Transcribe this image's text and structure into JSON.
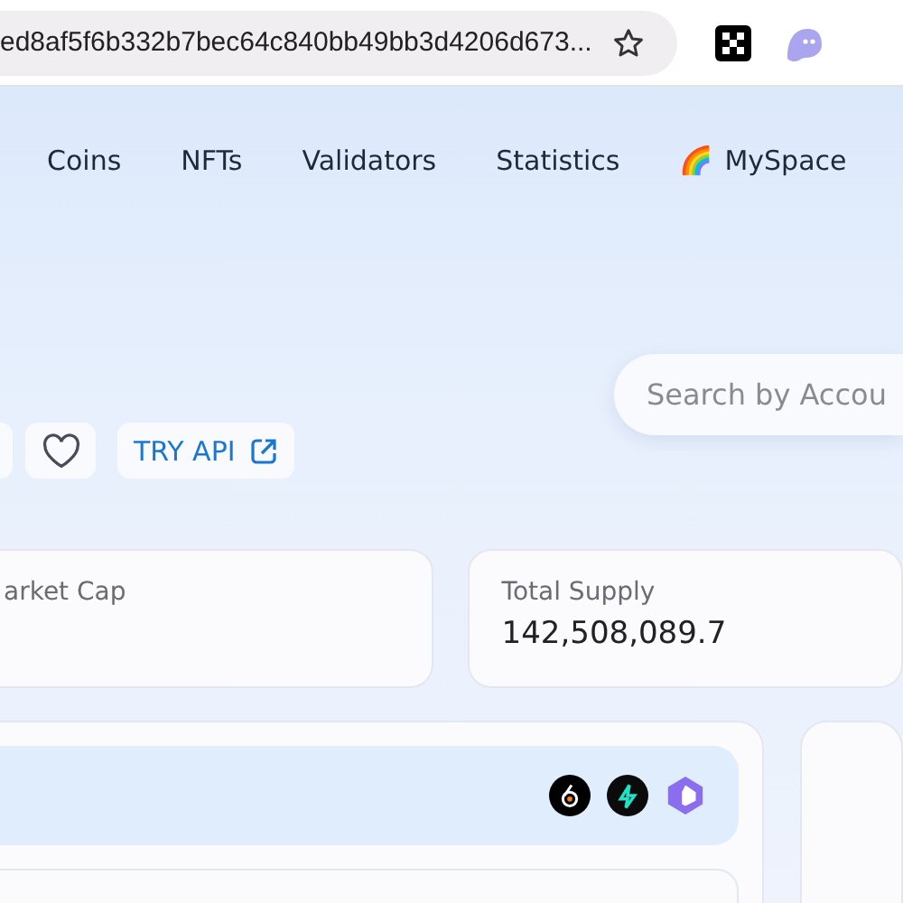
{
  "browser": {
    "url": "ed8af5f6b332b7bec64c840bb49bb3d4206d673..."
  },
  "nav": {
    "items": [
      {
        "label": "Coins"
      },
      {
        "label": "NFTs"
      },
      {
        "label": "Validators"
      },
      {
        "label": "Statistics"
      },
      {
        "label": "MySpace",
        "emoji": "🌈"
      }
    ]
  },
  "search": {
    "placeholder": "Search by Accou"
  },
  "actions": {
    "api_button": "TRY API"
  },
  "stats": [
    {
      "label": "arket Cap"
    },
    {
      "label": "Total Supply",
      "value": "142,508,089.7"
    }
  ]
}
